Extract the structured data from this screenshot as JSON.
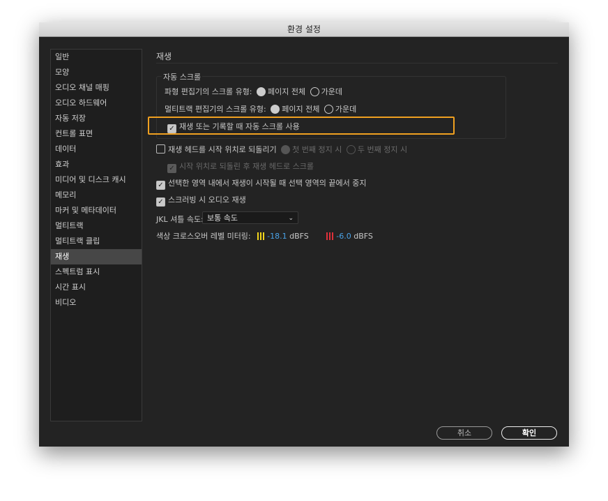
{
  "title": "환경 설정",
  "sidebar": {
    "items": [
      "일반",
      "모양",
      "오디오 채널 매핑",
      "오디오 하드웨어",
      "자동 저장",
      "컨트롤 표면",
      "데이터",
      "효과",
      "미디어 및 디스크 캐시",
      "메모리",
      "마커 및 메타데이터",
      "멀티트랙",
      "멀티트랙 클립",
      "재생",
      "스펙트럼 표시",
      "시간 표시",
      "비디오"
    ],
    "selected": "재생"
  },
  "main": {
    "section_title": "재생",
    "group_title": "자동 스크롤",
    "waveform_scroll_label": "파형 편집기의 스크롤 유형:",
    "multitrack_scroll_label": "멀티트랙 편집기의 스크롤 유형:",
    "opt_page": "페이지 전체",
    "opt_center": "가운데",
    "auto_scroll_check": "재생 또는 기록할 때 자동 스크롤 사용",
    "return_head": "재생 헤드를 시작 위치로 되돌리기",
    "first_stop": "첫 번째 정지 시",
    "second_stop": "두 번째 정지 시",
    "scroll_after_return": "시작 위치로 되돌린 후 재생 헤드로 스크롤",
    "stop_at_selection": "선택한 영역 내에서 재생이 시작될 때 선택 영역의 끝에서 중지",
    "scrub_audio": "스크러빙 시 오디오 재생",
    "jkl_label": "JKL 셔틀 속도:",
    "jkl_value": "보통 속도",
    "meter_label": "색상 크로스오버 레벨 미터링:",
    "yellow_value": "-18.1",
    "red_value": "-6.0",
    "unit": "dBFS",
    "colors": {
      "yellow": "#f2d51b",
      "red": "#e0303a",
      "value": "#4aa3e8",
      "highlight": "#f0a020"
    }
  },
  "buttons": {
    "cancel": "취소",
    "ok": "확인"
  }
}
